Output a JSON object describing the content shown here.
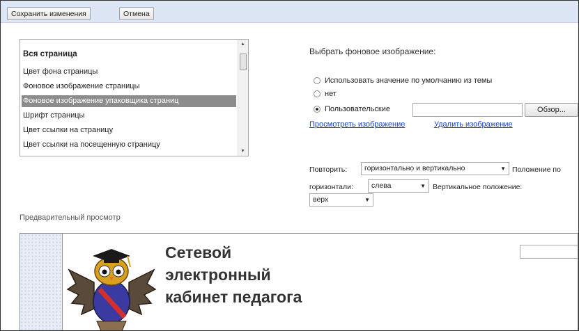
{
  "toolbar": {
    "save_label": "Сохранить изменения",
    "cancel_label": "Отмена"
  },
  "settings_list": {
    "items": [
      "Вся страница",
      "Цвет фона страницы",
      "Фоновое изображение страницы",
      "Фоновое изображение упаковщика страниц",
      "Шрифт страницы",
      "Цвет ссылки на страницу",
      "Цвет ссылки на посещенную страницу"
    ],
    "selected_index": 3
  },
  "background_image": {
    "title": "Выбрать фоновое изображение:",
    "options": [
      "Использовать значение по умолчанию из темы",
      "нет",
      "Пользовательские"
    ],
    "selected_option": 2,
    "custom_file_value": "",
    "browse_label": "Обзор...",
    "view_link": "Просмотреть изображение",
    "delete_link": "Удалить изображение"
  },
  "repeat": {
    "repeat_label": "Повторить:",
    "repeat_value": "горизонтально и вертикально",
    "hpos_label_1": "Положение по",
    "hpos_label_2": "горизонтали:",
    "hpos_value": "слева",
    "vpos_label": "Вертикальное положение:",
    "vpos_value": "верх"
  },
  "preview": {
    "label": "Предварительный просмотр",
    "site_title_lines": [
      "Сетевой",
      "электронный",
      "кабинет педагога"
    ],
    "search_value": ""
  },
  "colors": {
    "toolbar_bg": "#dde6f4",
    "link": "#1f3fbf",
    "selection": "#8c8c8c"
  }
}
